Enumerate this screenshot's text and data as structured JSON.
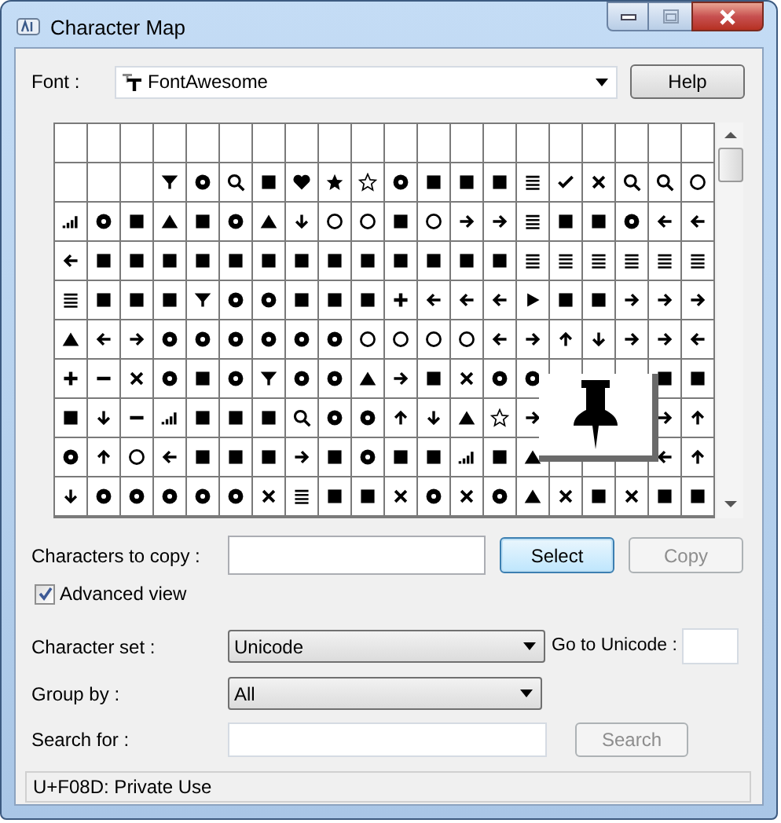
{
  "window": {
    "title": "Character Map"
  },
  "font": {
    "label": "Font :",
    "value": "FontAwesome"
  },
  "help_button": {
    "label": "Help"
  },
  "characters_to_copy": {
    "label": "Characters to copy :"
  },
  "buttons": [
    {
      "label": "Select",
      "disabled": false,
      "default": true
    },
    {
      "label": "Copy",
      "disabled": true,
      "default": false
    }
  ],
  "advanced_view": {
    "label": "Advanced view",
    "checked": true
  },
  "character_set": {
    "label": "Character set :",
    "value": "Unicode"
  },
  "go_to_unicode": {
    "label": "Go to Unicode :"
  },
  "group_by": {
    "label": "Group by :",
    "value": "All"
  },
  "search": {
    "label": "Search for :",
    "button": {
      "label": "Search",
      "disabled": true
    }
  },
  "status_bar": {
    "text": "U+F08D: Private Use"
  }
}
